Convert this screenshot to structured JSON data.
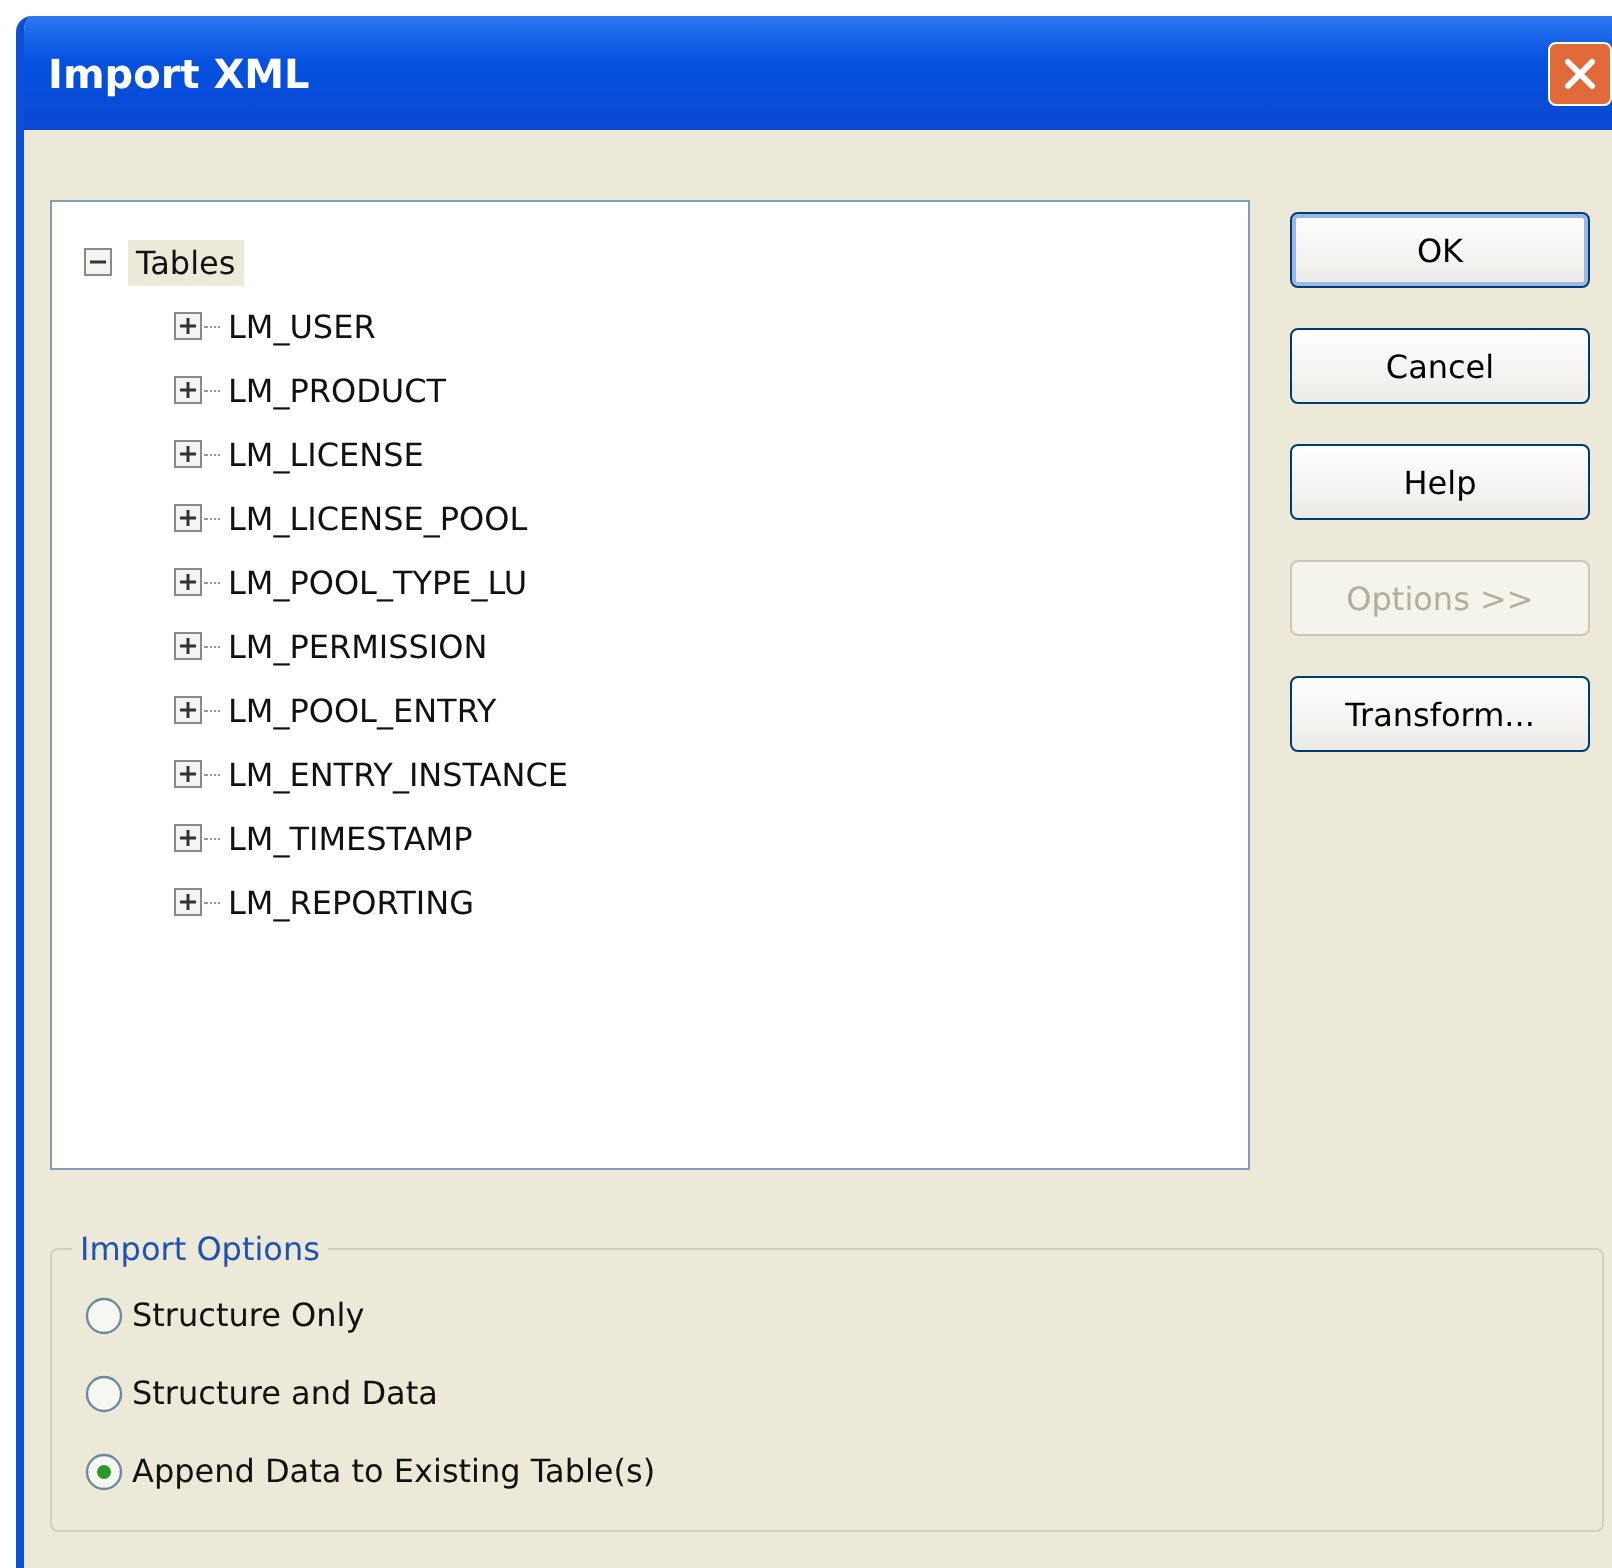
{
  "window": {
    "title": "Import XML"
  },
  "tree": {
    "label": "Tables",
    "expanded": true,
    "selected": true,
    "children": [
      {
        "label": "LM_USER",
        "expanded": false
      },
      {
        "label": "LM_PRODUCT",
        "expanded": false
      },
      {
        "label": "LM_LICENSE",
        "expanded": false
      },
      {
        "label": "LM_LICENSE_POOL",
        "expanded": false
      },
      {
        "label": "LM_POOL_TYPE_LU",
        "expanded": false
      },
      {
        "label": "LM_PERMISSION",
        "expanded": false
      },
      {
        "label": "LM_POOL_ENTRY",
        "expanded": false
      },
      {
        "label": "LM_ENTRY_INSTANCE",
        "expanded": false
      },
      {
        "label": "LM_TIMESTAMP",
        "expanded": false
      },
      {
        "label": "LM_REPORTING",
        "expanded": false
      }
    ]
  },
  "buttons": [
    {
      "label": "OK",
      "disabled": false,
      "default": true
    },
    {
      "label": "Cancel",
      "disabled": false,
      "default": false
    },
    {
      "label": "Help",
      "disabled": false,
      "default": false
    },
    {
      "label": "Options >>",
      "disabled": true,
      "default": false
    },
    {
      "label": "Transform...",
      "disabled": false,
      "default": false
    }
  ],
  "import_options": {
    "title": "Import Options",
    "options": [
      {
        "label": "Structure Only",
        "selected": false
      },
      {
        "label": "Structure and Data",
        "selected": false
      },
      {
        "label": "Append Data to Existing Table(s)",
        "selected": true
      }
    ]
  }
}
